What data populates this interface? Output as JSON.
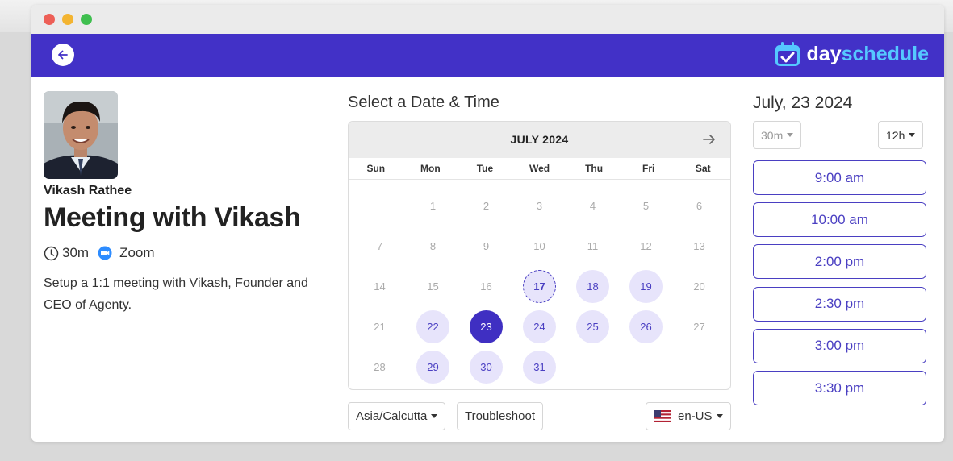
{
  "host": {
    "name": "Vikash Rathee"
  },
  "event": {
    "title": "Meeting with Vikash",
    "duration": "30m",
    "location": "Zoom",
    "description": "Setup a 1:1 meeting with Vikash, Founder and CEO of Agenty."
  },
  "brand": {
    "logo_part1": "day",
    "logo_part2": "schedule",
    "primary_color": "#4231c7",
    "accent_color": "#55c8ff"
  },
  "calendar": {
    "heading": "Select a Date & Time",
    "month_label": "JULY 2024",
    "weekdays": [
      "Sun",
      "Mon",
      "Tue",
      "Wed",
      "Thu",
      "Fri",
      "Sat"
    ],
    "weeks": [
      [
        null,
        "1",
        "2",
        "3",
        "4",
        "5",
        "6"
      ],
      [
        "7",
        "8",
        "9",
        "10",
        "11",
        "12",
        "13"
      ],
      [
        "14",
        "15",
        "16",
        "17",
        "18",
        "19",
        "20"
      ],
      [
        "21",
        "22",
        "23",
        "24",
        "25",
        "26",
        "27"
      ],
      [
        "28",
        "29",
        "30",
        "31",
        null,
        null,
        null
      ]
    ],
    "available_days": [
      "17",
      "18",
      "19",
      "22",
      "23",
      "24",
      "25",
      "26",
      "29",
      "30",
      "31"
    ],
    "today": "17",
    "selected": "23",
    "timezone": "Asia/Calcutta",
    "troubleshoot_label": "Troubleshoot",
    "locale": "en-US"
  },
  "slots_panel": {
    "date_heading": "July, 23 2024",
    "duration_option": "30m",
    "clock_format": "12h",
    "slots": [
      "9:00 am",
      "10:00 am",
      "2:00 pm",
      "2:30 pm",
      "3:00 pm",
      "3:30 pm"
    ]
  }
}
